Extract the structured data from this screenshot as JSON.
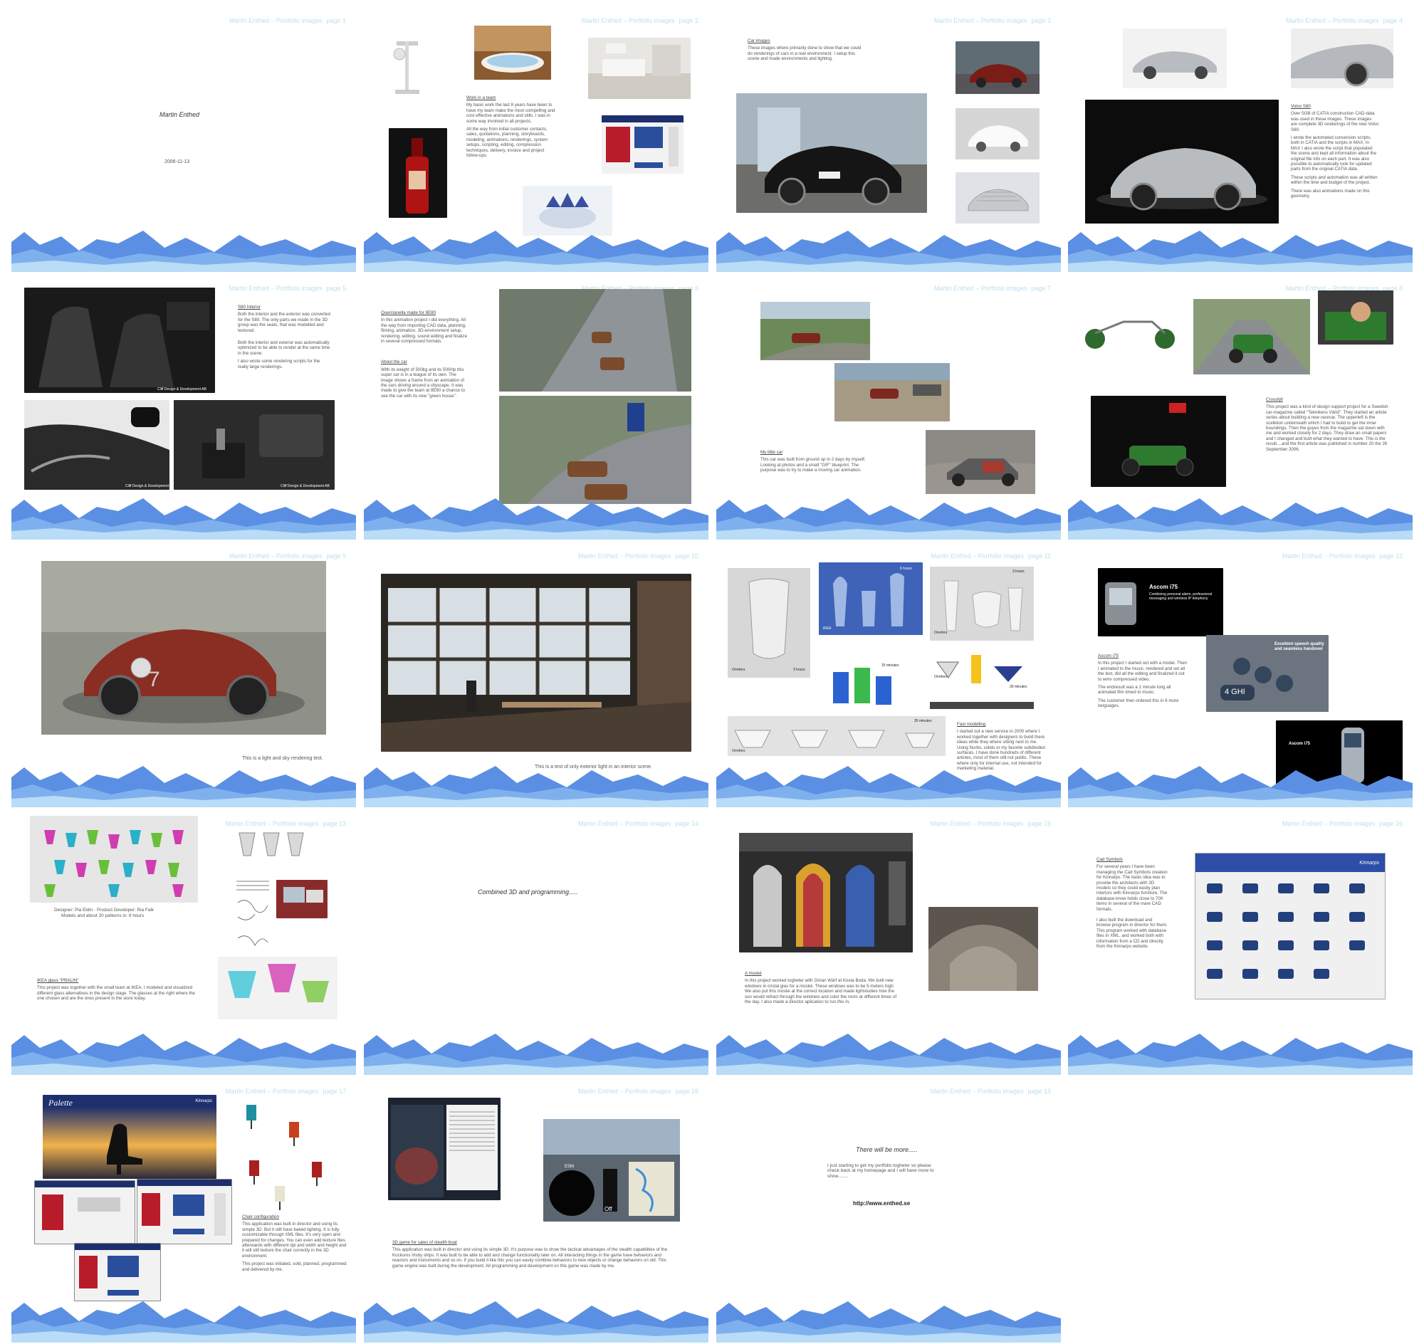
{
  "header_title": "Martin Enthed – Portfolio images",
  "pages": [
    {
      "page_label": "page 1",
      "author": "Martin Enthed",
      "date": "2006-11-13"
    },
    {
      "page_label": "page 2",
      "section_title": "Work in a team",
      "paragraphs": [
        "My basic work the last 8 years have been to have my team make the most compelling and cost effective animations and stills. I was in some way involved in all projects.",
        "All the way from initial customer contacts, sales, quotations, planning, storyboards, modeling, animations, renderings, system setups, scripting, editing, compression techniques, delivery, invoice and project follow-ups."
      ]
    },
    {
      "page_label": "page 3",
      "section_title": "Car images",
      "paragraphs": [
        "These images where primarily done to show that we could do renderings of cars in a real environment. I setup this scene and made environments and lighting."
      ]
    },
    {
      "page_label": "page 4",
      "section_title": "Volvo S80",
      "paragraphs": [
        "Over 5GB of CATIA construction CAD-data was used in these images. These images are complete 3D renderings of the new Volvo S80.",
        "I wrote the automated conversion scripts, both in CATIA and the scripts in MAX. In MAX I also wrote the script that populated the scene and kept all information about the original file info on each part. It was also possible to automatically look for updated parts from the original CATIA data.",
        "These scripts and automation was all written within the time and budget of the project.",
        "There was also animations made on this geometry."
      ]
    },
    {
      "page_label": "page 5",
      "section_title": "S80 Interior",
      "paragraphs": [
        "Both the interior and the exterior was converted for the S80. The only parts we made in the 3D group was the seats, that was modelled and textured.",
        "Both the interior and exterior was automatically optimized to be able to render at the same time in the scene.",
        "I also wrote some rendering scripts for the really large renderings."
      ],
      "watermark": "Cliff Design & Development AB"
    },
    {
      "page_label": "page 6",
      "section_title": "Quercianella made for 8E80",
      "paragraphs": [
        "In this animation project I did everything. All the way from importing CAD data, planning, filming, animation, 3D-environment setup, rendering, editing, sound editing and finalize in several compressed formats."
      ],
      "section_title_2": "About the car",
      "paragraphs_2": [
        "With its weight of 500kg and its 500Hp this super car is in a league of its own. The image shows a frame from an animation of the cars driving around a cityscape. It was made to give the team at 8E80 a chance to see the car with its new \"green house\"."
      ]
    },
    {
      "page_label": "page 7",
      "section_title": "My little car",
      "paragraphs": [
        "This car was built from ground up in 2 days by myself. Looking at photos and a small \"GIF\" blueprint. The purpose was to try to make a moving car animation."
      ]
    },
    {
      "page_label": "page 8",
      "section_title": "Crossfyll",
      "paragraphs": [
        "This project was a kind of design support project for a Swedish car-magazine called \"Teknikens Värld\". They started an article series about building a new racecar. The upperleft is the scelleton underneath which I had to build to get the inner boundings. Then the guyes from the magazine sat down with me and worked closely for 2 days. They draw an small papers and I changed and built what they wanted to have. This is the result....and the first article was published in number 20 the 26 September 2006."
      ]
    },
    {
      "page_label": "page 9",
      "caption": "This is a light and sky rendering test."
    },
    {
      "page_label": "page 10",
      "caption": "This is a test of only exterior light in an interior scene."
    },
    {
      "page_label": "page 11",
      "section_title": "Fast modelling",
      "paragraphs": [
        "I started out a new service in 2000 where I worked together with designers to build there ideas while they where sitting next to me. Using Nurbs, solids or my favorite subdivided surfaces. I have done hundreds of different articles, most of them still not public. These where only for internal use, not intended for marketing material."
      ],
      "labels": {
        "orrefors": "Orrefors",
        "ikea": "IKEA",
        "h3": "3 hours",
        "h6": "6 hours",
        "m15": "15 minutes",
        "m30": "30 minutes",
        "m35": "35 minutes"
      }
    },
    {
      "page_label": "page 12",
      "section_title": "Ascom i75",
      "paragraphs": [
        "In this project I started out with a model. Then I animated to the music, rendered and set all the text, did all the editing and finalized it out to wmv compressed video.",
        "The endresult was a 1 minute long all animated film timed to music.",
        "The customer then ordered this in 6 more languages."
      ],
      "screen_title": "Ascom i75",
      "screen_sub": "Combining personal alarm, professional messaging and wireless IP telephony",
      "quality": "Excellent speech quality and seamless handover",
      "key_text": "4 GHI"
    },
    {
      "page_label": "page 13",
      "credits": "Designer: Pia Eldin · Product Developer: Ria Falk",
      "credits2": "Models and about 20 patterns in: 8 hours",
      "section_title": "IKEA glass \"PRALIN\"",
      "paragraphs": [
        "This project was together with the small team at IKEA. I modeled and visualized different glass alternatives in the design stage. The glasses at the right where the one chosen and are the ones present in the store today."
      ]
    },
    {
      "page_label": "page 14",
      "big_text": "Combined 3D and programming....."
    },
    {
      "page_label": "page 15",
      "section_title": "A moské",
      "paragraphs": [
        "In this project worked togheter with Göran Wärf at Kosta Boda. We built new windows in cristal glas for a moské. These windows was to be 5 meters high. We also put this moske at the correct location and made lightstudies how the sun would refract through the windows and color the room at different times of the day. I also made a director aplication to run this in."
      ]
    },
    {
      "page_label": "page 16",
      "section_title": "Cad Symbols",
      "paragraphs": [
        "For several years I have been managing the Cad Symbols creation for Kinnarps. The basic idea was to provide the architects with 3D models so they could easily plan interiors with Kinnarps furniture. The database know holds close to 700 items in several of the mare CAD formats.",
        "I also built the download and browse program in director for them. This program worked with database files in XML, and worked both with information from a CD and directly from the Kinnarps website."
      ],
      "app_brand": "Kinnarps"
    },
    {
      "page_label": "page 17",
      "section_title": "Chair configuration",
      "paragraphs": [
        "This application was built in director and using its simple 3D. But it still have baked lighting. It is fully customizable through XML files. It's very open and prepared for changes. You can even add texture files afterwards with different dpi and width and height and it will still texture the chair correctly in the 3D environment.",
        "This project was initiated, sold, planned, programmed and delivered by me."
      ],
      "app_title": "Palette",
      "app_brand": "Kinnarps"
    },
    {
      "page_label": "page 18",
      "section_title": "3D game for sales of stealth boat",
      "paragraphs": [
        "This application was built in director and using its simple 3D. It's purpose was to show the tactical advantages of the stealth capabilities of the Kockums Visby ships. It was built to be able to add and change functionality later on. All interacting things in the game have behaviors and reactors and instruments and so on. If you build it like this you can easily combine behaviors to new objects or change behaviors on old. This game engine was built during the development. All programming and development on this game was made by me."
      ],
      "esm": "ESM",
      "off": "Off"
    },
    {
      "page_label": "page 19",
      "big_text": "There will be more.....",
      "paragraphs": [
        "I just starting to get my portfolio togheter so please check back at my homepage and I will have more to show........"
      ],
      "url": "http://www.enthed.se"
    }
  ],
  "colors": {
    "wave_dark": "#5b8fe3",
    "wave_mid": "#7fb0ee",
    "wave_light": "#b9dcf7",
    "header": "#bde0ee"
  }
}
